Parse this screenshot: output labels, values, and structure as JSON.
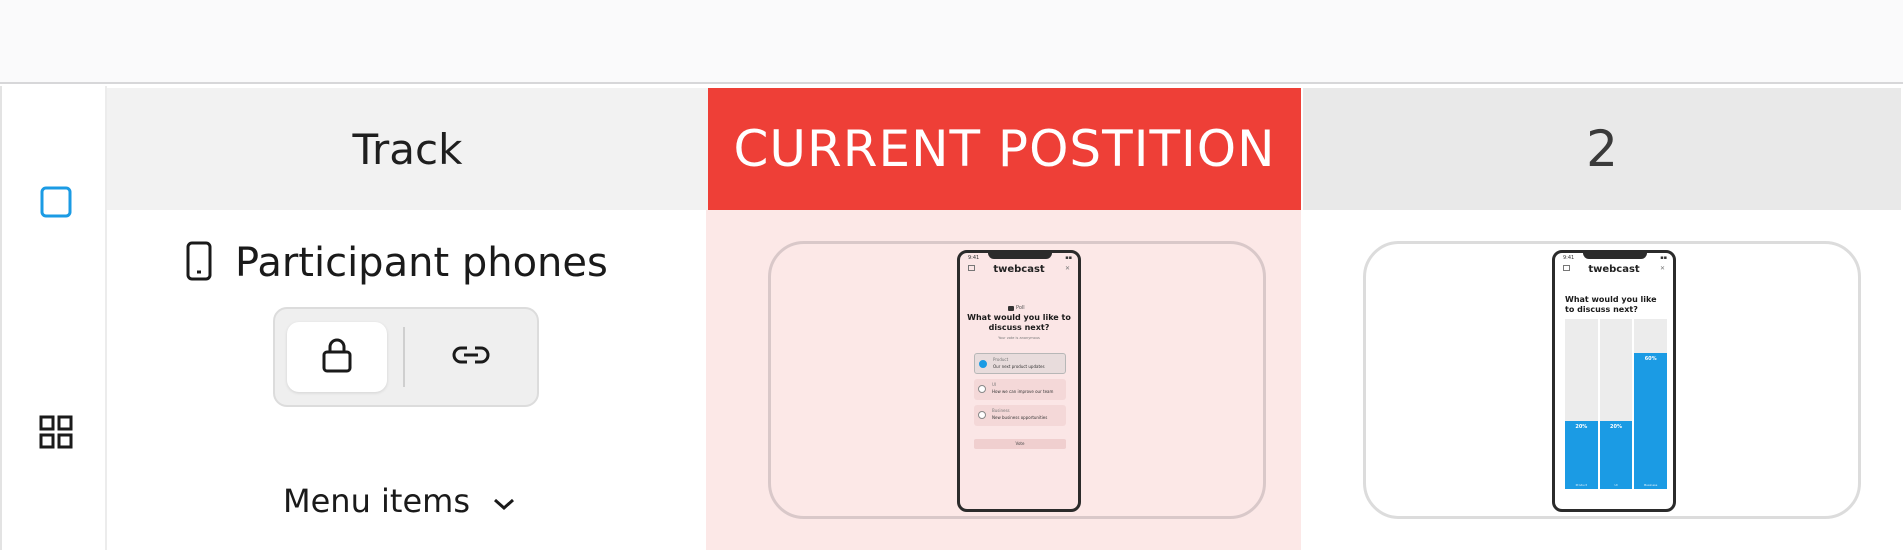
{
  "header": {
    "track": "Track",
    "current": "CURRENT POSTITION",
    "next": "2"
  },
  "track": {
    "participant_label": "Participant phones",
    "menu_items_label": "Menu items"
  },
  "icons": {
    "rail_slide": "square-outline-icon",
    "rail_grid": "grid-icon",
    "phone": "mobile-phone-icon",
    "lock": "lock-icon",
    "link": "link-icon",
    "chevron": "chevron-down-icon"
  },
  "colors": {
    "current_header": "#ee3f37",
    "current_bg": "#fce8e7",
    "accent_blue": "#1b9be4"
  },
  "preview_current": {
    "time": "9:41",
    "brand": "twebcast",
    "tag": "Poll",
    "question": "What would you like to discuss next?",
    "subtitle": "Your vote is anonymous",
    "options": [
      {
        "k": "Product",
        "t": "Our next product updates"
      },
      {
        "k": "UI",
        "t": "How we can improve our team"
      },
      {
        "k": "Business",
        "t": "New business opportunities"
      }
    ],
    "vote_button": "Vote"
  },
  "preview_next": {
    "time": "9:41",
    "brand": "twebcast",
    "question": "What would you like to discuss next?",
    "results": [
      {
        "pct_label": "20%",
        "value": 0.2,
        "cat": "Product"
      },
      {
        "pct_label": "20%",
        "value": 0.2,
        "cat": "UI"
      },
      {
        "pct_label": "60%",
        "value": 0.6,
        "cat": "Business"
      }
    ]
  }
}
